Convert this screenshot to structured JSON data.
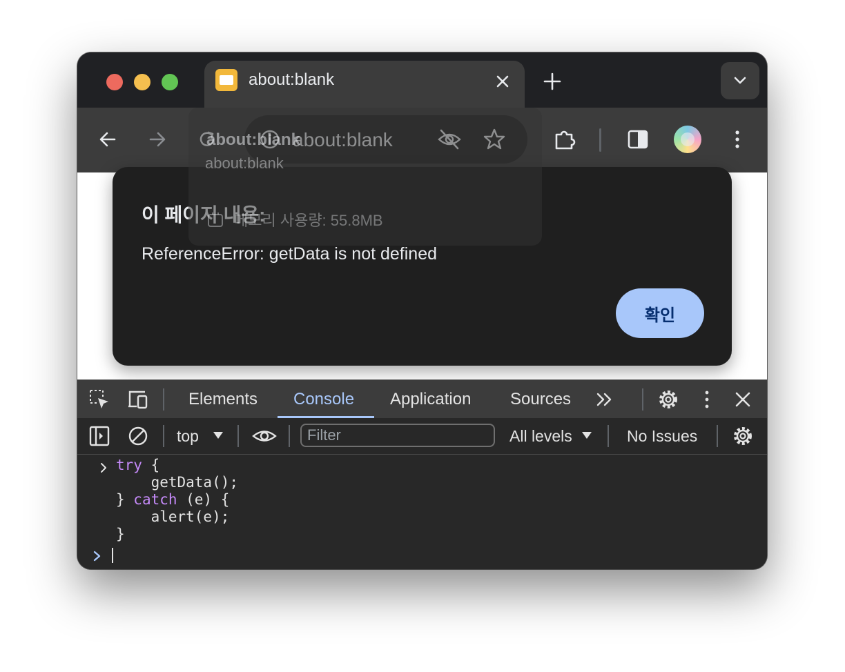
{
  "browser": {
    "tab": {
      "title": "about:blank"
    },
    "omnibox": {
      "url": "about:blank"
    },
    "hover_card": {
      "title": "about:blank",
      "url": "about:blank",
      "memory": "메모리 사용량: 55.8MB"
    }
  },
  "dialog": {
    "title": "이 페이지 내용:",
    "message": "ReferenceError: getData is not defined",
    "ok_label": "확인"
  },
  "devtools": {
    "tabs": [
      {
        "label": "Elements"
      },
      {
        "label": "Console",
        "active": true
      },
      {
        "label": "Application"
      },
      {
        "label": "Sources"
      }
    ],
    "context": "top",
    "filter_placeholder": "Filter",
    "levels": "All levels",
    "issues": "No Issues",
    "console_input": {
      "kw_try": "try",
      "brace_open": " {",
      "line2": "    getData();",
      "close_brace": "} ",
      "kw_catch": "catch",
      "catch_rest": " (e) {",
      "line4": "    alert(e);",
      "line5": "}"
    }
  },
  "icons": {
    "close": "close-icon",
    "new_tab": "plus-icon",
    "tab_search": "chevron-down-icon",
    "back": "arrow-left-icon",
    "forward": "arrow-right-icon",
    "reload": "reload-icon",
    "site_info": "info-icon",
    "tracking": "eye-slash-icon",
    "bookmark": "star-icon",
    "extensions": "puzzle-icon",
    "side_panel": "side-panel-icon",
    "menu": "kebab-icon"
  },
  "colors": {
    "traffic_red": "#ed6a5e",
    "traffic_yellow": "#f5bf4f",
    "traffic_green": "#62c554",
    "accent": "#a8c7fa",
    "keyword": "#c58af9"
  }
}
